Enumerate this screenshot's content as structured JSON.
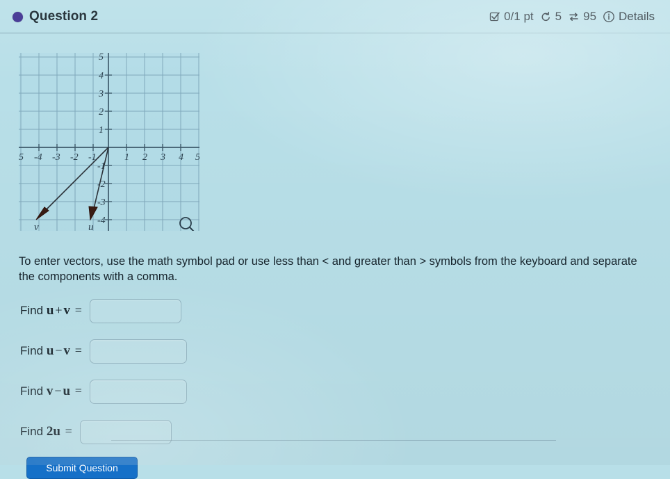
{
  "header": {
    "bullet_icon": "filled-circle-icon",
    "title": "Question 2",
    "points": "0/1 pt",
    "points_icon": "checkbox-checked-icon",
    "attempts_icon": "retry-circular-arrow-icon",
    "attempts": "5",
    "shuffle_icon": "swap-arrows-icon",
    "shuffle_count": "95",
    "details_icon": "info-circle-icon",
    "details_label": "Details"
  },
  "graph": {
    "zoom_icon": "magnifier-icon",
    "x_ticks": [
      "5",
      "-4",
      "-3",
      "-2",
      "-1",
      "1",
      "2",
      "3",
      "4",
      "5"
    ],
    "y_ticks": [
      "5",
      "4",
      "3",
      "2",
      "1",
      "-1",
      "-2",
      "-3",
      "-4"
    ],
    "vector_labels": {
      "v": "v",
      "u": "u"
    }
  },
  "chart_data": {
    "type": "scatter",
    "title": "",
    "xlabel": "",
    "ylabel": "",
    "xlim": [
      -5,
      5
    ],
    "ylim": [
      -5,
      5
    ],
    "grid": true,
    "legend": "none",
    "vectors": [
      {
        "name": "v",
        "tail": [
          0,
          0
        ],
        "head": [
          -4,
          -4
        ],
        "label": "v",
        "label_at": [
          -4,
          -4.6
        ]
      },
      {
        "name": "u",
        "tail": [
          0,
          0
        ],
        "head": [
          -1,
          -4
        ],
        "label": "u",
        "label_at": [
          -1,
          -4.6
        ]
      }
    ]
  },
  "instructions": {
    "line1": "To enter vectors, use the math symbol pad or use less than < and greater than > symbols from the keyboard",
    "line2": "and separate the components with a comma."
  },
  "questions": [
    {
      "find": "Find",
      "a": "u",
      "op": "+",
      "b": "v",
      "eq": "=",
      "value": "",
      "placeholder": ""
    },
    {
      "find": "Find",
      "a": "u",
      "op": "−",
      "b": "v",
      "eq": "=",
      "value": "",
      "placeholder": ""
    },
    {
      "find": "Find",
      "a": "v",
      "op": "−",
      "b": "u",
      "eq": "=",
      "value": "",
      "placeholder": ""
    },
    {
      "find": "Find",
      "a": "2u",
      "op": "",
      "b": "",
      "eq": "=",
      "value": "",
      "placeholder": ""
    }
  ],
  "footer": {
    "submit_label": "Submit Question"
  },
  "colors": {
    "page_bg": "#b8dfe8",
    "bullet": "#3b2d8f",
    "text": "#16242c",
    "grid": "#7fa8bb",
    "axis": "#3d5a6b",
    "button": "#1570c8"
  }
}
